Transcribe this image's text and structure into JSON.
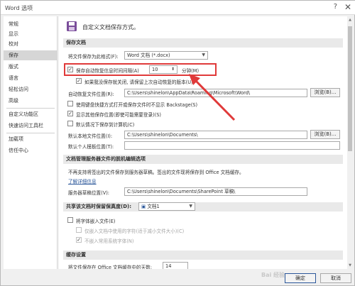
{
  "window": {
    "title": "Word 选项",
    "help_glyph": "?",
    "close_glyph": "✕"
  },
  "sidebar": {
    "items": [
      {
        "label": "常规"
      },
      {
        "label": "显示"
      },
      {
        "label": "校对"
      },
      {
        "label": "保存",
        "selected": true
      },
      {
        "label": "版式"
      },
      {
        "label": "语言"
      },
      {
        "label": "轻松访问"
      },
      {
        "label": "高级"
      },
      {
        "label": "自定义功能区"
      },
      {
        "label": "快速访问工具栏"
      },
      {
        "label": "加载项"
      },
      {
        "label": "信任中心"
      }
    ]
  },
  "header": {
    "text": "自定义文档保存方式。",
    "icon": "save-document-icon"
  },
  "save_docs": {
    "section_title": "保存文档",
    "format_label": "将文件保存为此格式(F):",
    "format_value": "Word 文档 (*.docx)",
    "autorecover_label": "保存自动恢复信息时间间隔(A)",
    "autorecover_checked": true,
    "autorecover_minutes": "10",
    "minutes_label": "分钟(M)",
    "keep_last_label": "如果我没保存就关闭, 请保留上次自动恢复的版本(U)",
    "keep_last_checked": true,
    "autorecover_location_label": "自动恢复文件位置(R):",
    "autorecover_location_value": "C:\\Users\\shinelon\\AppData\\Roaming\\Microsoft\\Word\\",
    "browse_label": "浏览(B)...",
    "no_backstage_label": "使用键盘快捷方式打开或保存文件时不显示 Backstage(S)",
    "no_backstage_checked": false,
    "show_more_label": "显示其他保存位置(即使可能需要登录)(S)",
    "show_more_checked": true,
    "save_to_computer_label": "默认情况下保存到计算机(C)",
    "save_to_computer_checked": false,
    "local_location_label": "默认本地文件位置(I):",
    "local_location_value": "C:\\Users\\shinelon\\Documents\\",
    "browse2_label": "浏览(B)...",
    "personal_templates_label": "默认个人模板位置(T):",
    "personal_templates_value": ""
  },
  "server": {
    "section_title": "文档管理服务器文件的脱机编辑选项",
    "note": "不再支持将签出的文件保存到服务器草稿。签出的文件现将保存到 Office 文档缓存。",
    "learn_more": "了解详细信息",
    "drafts_label": "服务器草稿位置(V):",
    "drafts_value": "C:\\Users\\shinelon\\Documents\\SharePoint 草稿\\",
    "browse3_label": "浏览(B)..."
  },
  "fidelity": {
    "section_title": "共享该文档时保留保真度(D):",
    "doc_value": "文档1",
    "embed_fonts_label": "将字体嵌入文件(E)",
    "embed_chars_label": "仅嵌入文档中使用的字符(适于减小文件大小)(C)",
    "no_common_label": "不嵌入常用系统字体(N)"
  },
  "cache": {
    "section_title": "缓存设置",
    "days_label": "将文件保存在 Office 文档缓存中的天数:",
    "days_value": "14"
  },
  "footer": {
    "ok_label": "确定",
    "cancel_label": "取消"
  },
  "watermark": "Bai 经验",
  "colors": {
    "accent": "#2b579a",
    "highlight": "#e03a3a",
    "selected_nav": "#d6d6d6"
  }
}
